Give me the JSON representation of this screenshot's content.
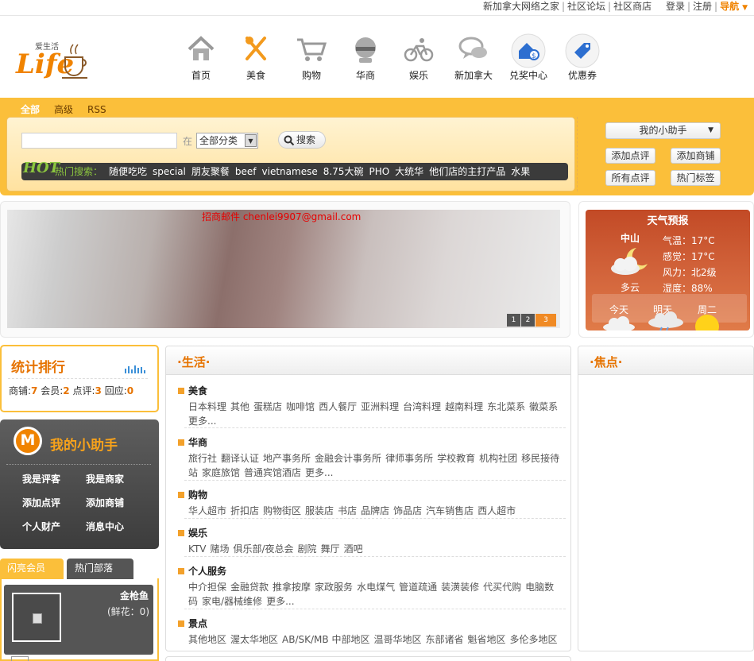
{
  "top_links": {
    "l1": "新加拿大网络之家",
    "l2": "社区论坛",
    "l3": "社区商店",
    "l4": "登录",
    "l5": "注册",
    "l6": "导航"
  },
  "logo": {
    "text": "Life",
    "sub": "爱生活"
  },
  "nav": [
    {
      "label": "首页",
      "icon": "home-icon"
    },
    {
      "label": "美食",
      "icon": "fork-knife-icon"
    },
    {
      "label": "购物",
      "icon": "cart-icon"
    },
    {
      "label": "华商",
      "icon": "shop-icon"
    },
    {
      "label": "娱乐",
      "icon": "bicycle-icon"
    },
    {
      "label": "新加拿大",
      "icon": "chat-icon"
    },
    {
      "label": "兑奖中心",
      "icon": "prize-icon"
    },
    {
      "label": "优惠券",
      "icon": "coupon-icon"
    }
  ],
  "search": {
    "tab_all": "全部",
    "tab_adv": "高级",
    "tab_rss": "RSS",
    "in": "在",
    "category": "全部分类",
    "button": "搜索",
    "hot_label": "热门搜索：",
    "hot": [
      "随便吃吃",
      "special",
      "朋友聚餐",
      "beef",
      "vietnamese",
      "8.75大碗",
      "PHO",
      "大统华",
      "他们店的主打产品",
      "水果"
    ]
  },
  "helper_box": {
    "dropdown": "我的小助手",
    "b1": "添加点评",
    "b2": "添加商铺",
    "b3": "所有点评",
    "b4": "热门标签"
  },
  "banner": {
    "mail": "招商邮件 chenlei9907@gmail.com",
    "pages": [
      "1",
      "2",
      "3"
    ]
  },
  "weather": {
    "title": "天气预报",
    "city": "中山",
    "cond": "多云",
    "temp": "气温：17°C",
    "feel": "感觉：17°C",
    "wind": "风力：北2级",
    "humid": "湿度：88%",
    "today": "今天",
    "tomorrow": "明天",
    "tuesday": "周二"
  },
  "stats": {
    "title": "统计排行",
    "shops_l": "商铺:",
    "shops": "7",
    "members_l": "会员:",
    "members": "2",
    "reviews_l": "点评:",
    "reviews": "3",
    "replies_l": "回应:",
    "replies": "0"
  },
  "helper_panel": {
    "logo": "M",
    "title": "我的小助手",
    "l1": "我是评客",
    "l2": "我是商家",
    "l3": "添加点评",
    "l4": "添加商铺",
    "l5": "个人财产",
    "l6": "消息中心"
  },
  "member_tabs": {
    "t1": "闪亮会员",
    "t2": "热门部落"
  },
  "member": {
    "name": "金枪鱼",
    "flowers": "(鲜花：0)"
  },
  "life": {
    "title": "·生活·",
    "cats": [
      {
        "name": "美食",
        "items": [
          "日本料理",
          "其他",
          "蛋糕店",
          "咖啡馆",
          "西人餐厅",
          "亚洲料理",
          "台湾料理",
          "越南料理",
          "东北菜系",
          "徽菜系",
          "更多..."
        ]
      },
      {
        "name": "华商",
        "items": [
          "旅行社",
          "翻译认证",
          "地产事务所",
          "金融会计事务所",
          "律师事务所",
          "学校教育",
          "机构社团",
          "移民接待站",
          "家庭旅馆",
          "普通宾馆酒店",
          "更多..."
        ]
      },
      {
        "name": "购物",
        "items": [
          "华人超市",
          "折扣店",
          "购物街区",
          "服装店",
          "书店",
          "品牌店",
          "饰品店",
          "汽车销售店",
          "西人超市"
        ]
      },
      {
        "name": "娱乐",
        "items": [
          "KTV",
          "赌场",
          "俱乐部/夜总会",
          "剧院",
          "舞厅",
          "酒吧"
        ]
      },
      {
        "name": "个人服务",
        "items": [
          "中介担保",
          "金融贷款",
          "推拿按摩",
          "家政服务",
          "水电煤气",
          "管道疏通",
          "装潢装修",
          "代买代购",
          "电脑数码",
          "家电/器械维修",
          "更多..."
        ]
      },
      {
        "name": "景点",
        "items": [
          "其他地区",
          "渥太华地区",
          "AB/SK/MB 中部地区",
          "温哥华地区",
          "东部诸省",
          "魁省地区",
          "多伦多地区"
        ]
      }
    ]
  },
  "focus": {
    "title": "·焦点·"
  },
  "colors": {
    "accent": "#f08300",
    "panel": "#fbbf3a",
    "dark": "#444444",
    "weather": "#c9532c"
  }
}
